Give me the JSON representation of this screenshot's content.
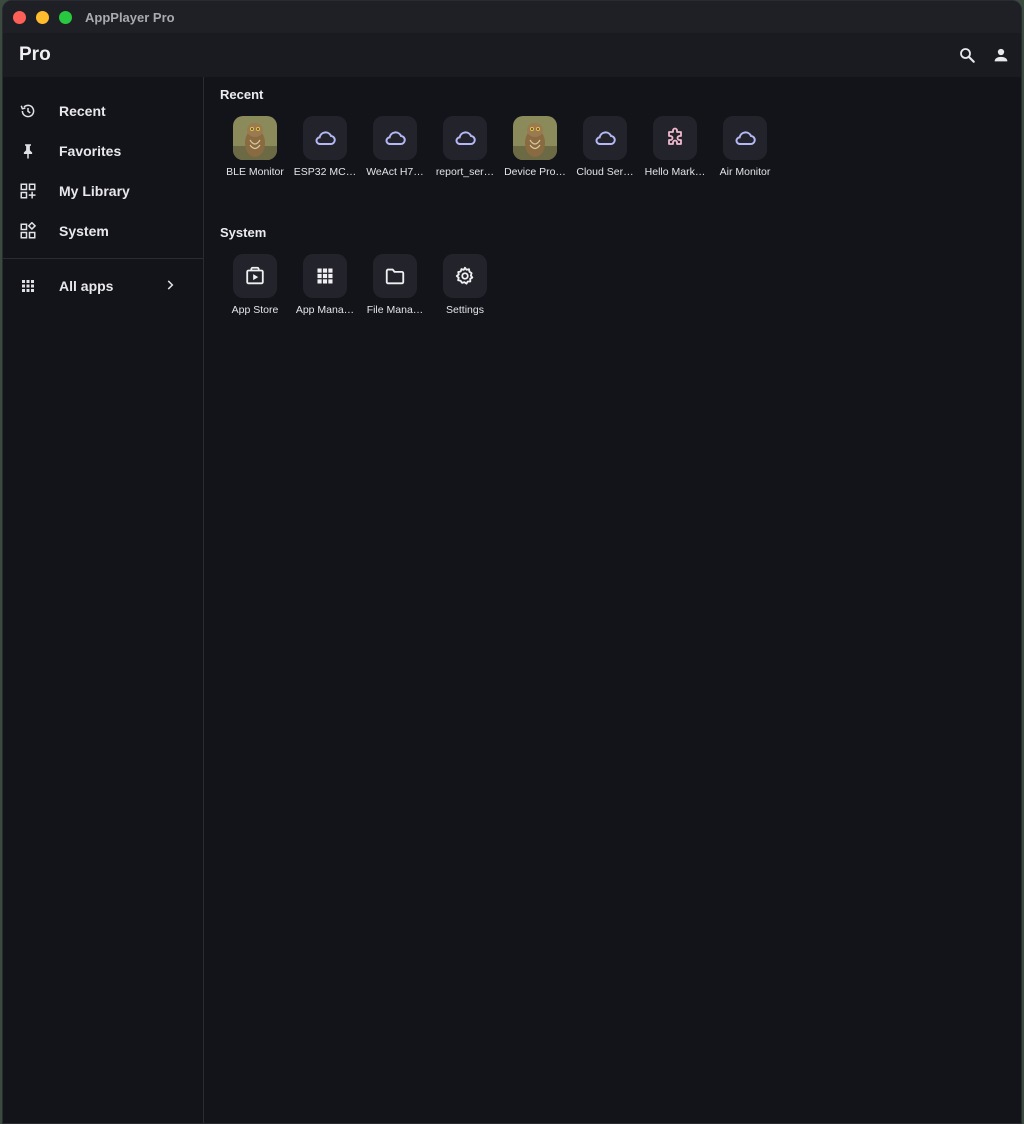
{
  "window": {
    "title": "AppPlayer Pro"
  },
  "appbar": {
    "title": "Pro",
    "search_icon": "search-icon",
    "account_icon": "person-icon"
  },
  "sidebar": {
    "items": [
      {
        "label": "Recent",
        "icon": "history-icon"
      },
      {
        "label": "Favorites",
        "icon": "pin-icon"
      },
      {
        "label": "My Library",
        "icon": "library-icon"
      },
      {
        "label": "System",
        "icon": "widgets-icon"
      }
    ],
    "all_apps": {
      "label": "All apps",
      "icon": "grid-icon"
    }
  },
  "recent": {
    "title": "Recent",
    "apps": [
      {
        "label": "BLE Monitor",
        "icon": "owl-image"
      },
      {
        "label": "ESP32 MC…",
        "icon": "cloud-icon"
      },
      {
        "label": "WeAct H7…",
        "icon": "cloud-icon"
      },
      {
        "label": "report_ser…",
        "icon": "cloud-icon"
      },
      {
        "label": "Device Pro…",
        "icon": "owl-image"
      },
      {
        "label": "Cloud Ser…",
        "icon": "cloud-icon"
      },
      {
        "label": "Hello Mark…",
        "icon": "puzzle-icon"
      },
      {
        "label": "Air Monitor",
        "icon": "cloud-icon"
      }
    ]
  },
  "system": {
    "title": "System",
    "apps": [
      {
        "label": "App Store",
        "icon": "store-icon"
      },
      {
        "label": "App Mana…",
        "icon": "apps-grid-icon"
      },
      {
        "label": "File Mana…",
        "icon": "folder-icon"
      },
      {
        "label": "Settings",
        "icon": "gear-icon"
      }
    ]
  },
  "colors": {
    "accent_cloud": "#b5b8f5",
    "accent_puzzle": "#f0b8d0",
    "background": "#131419"
  }
}
